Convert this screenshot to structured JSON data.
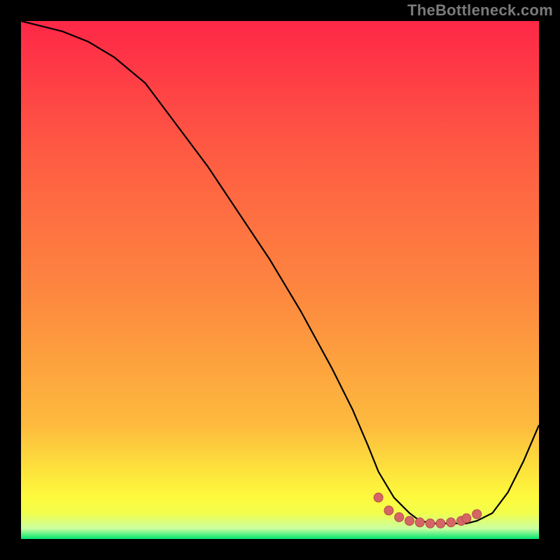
{
  "watermark": "TheBottleneck.com",
  "colors": {
    "background": "#000000",
    "gradient_top": "#fe2747",
    "gradient_upper_mid": "#fd8a3f",
    "gradient_mid": "#fde83c",
    "gradient_low_a": "#fdfa3d",
    "gradient_low_b": "#f2fe4c",
    "gradient_low_c": "#c9ffa1",
    "gradient_bottom": "#00e46f",
    "curve": "#000000",
    "marker_fill": "#d56666",
    "marker_stroke": "#b64a4a"
  },
  "chart_data": {
    "type": "line",
    "title": "",
    "xlabel": "",
    "ylabel": "",
    "xlim": [
      0,
      100
    ],
    "ylim": [
      0,
      100
    ],
    "grid": false,
    "legend": false,
    "series": [
      {
        "name": "bottleneck-curve",
        "x": [
          0,
          4,
          8,
          13,
          18,
          24,
          30,
          36,
          42,
          48,
          54,
          60,
          64,
          67,
          69,
          72,
          75,
          77,
          80,
          83,
          86,
          88,
          91,
          94,
          97,
          100
        ],
        "values": [
          100,
          99,
          98,
          96,
          93,
          88,
          80,
          72,
          63,
          54,
          44,
          33,
          25,
          18,
          13,
          8,
          5,
          3.5,
          3,
          3,
          3,
          3.5,
          5,
          9,
          15,
          22
        ]
      }
    ],
    "markers": {
      "name": "optimal-region-markers",
      "x": [
        69,
        71,
        73,
        75,
        77,
        79,
        81,
        83,
        85,
        86,
        88
      ],
      "values": [
        8,
        5.5,
        4.2,
        3.5,
        3.2,
        3,
        3,
        3.2,
        3.5,
        4,
        4.8
      ]
    },
    "gradient_stops_pct": [
      0,
      25,
      54,
      78,
      88,
      92,
      95,
      98,
      100
    ]
  }
}
